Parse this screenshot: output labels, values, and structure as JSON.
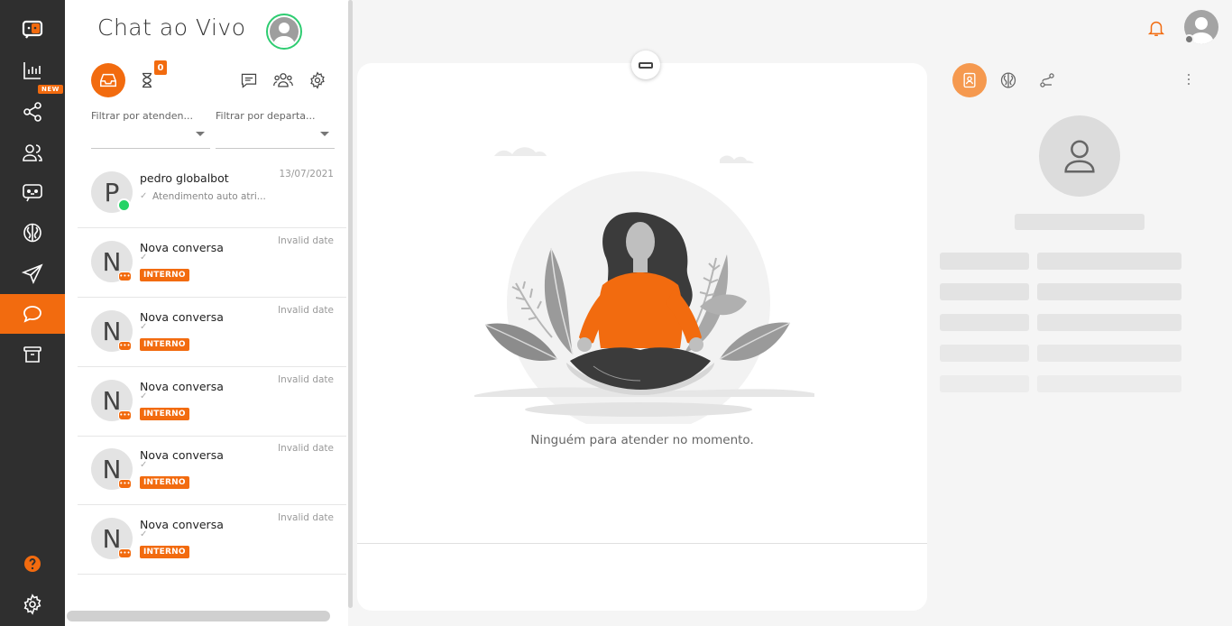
{
  "nav": {
    "items": [
      {
        "name": "logo",
        "icon": "chat-bot-logo-icon"
      },
      {
        "name": "dashboard",
        "icon": "bar-chart-icon"
      },
      {
        "name": "integrations",
        "icon": "share-nodes-icon",
        "badge": "NEW"
      },
      {
        "name": "contacts",
        "icon": "users-icon"
      },
      {
        "name": "bots",
        "icon": "bot-chat-icon"
      },
      {
        "name": "ai",
        "icon": "brain-icon"
      },
      {
        "name": "campaigns",
        "icon": "paper-plane-icon"
      },
      {
        "name": "live-chat",
        "icon": "chat-bubble-icon",
        "active": true
      },
      {
        "name": "archive",
        "icon": "archive-box-icon"
      },
      {
        "name": "help",
        "icon": "help-icon"
      },
      {
        "name": "settings",
        "icon": "gear-icon"
      }
    ]
  },
  "panel": {
    "title": "Chat ao Vivo",
    "queue_count": "0",
    "filter_agent": "Filtrar por atenden...",
    "filter_department": "Filtrar por departa...",
    "conversations": [
      {
        "initial": "P",
        "name": "pedro globalbot",
        "date": "13/07/2021",
        "preview": "Atendimento auto atri...",
        "badge": "",
        "channel": "whatsapp"
      },
      {
        "initial": "N",
        "name": "Nova conversa",
        "date": "Invalid date",
        "preview": "",
        "badge": "INTERNO",
        "channel": "internal"
      },
      {
        "initial": "N",
        "name": "Nova conversa",
        "date": "Invalid date",
        "preview": "",
        "badge": "INTERNO",
        "channel": "internal"
      },
      {
        "initial": "N",
        "name": "Nova conversa",
        "date": "Invalid date",
        "preview": "",
        "badge": "INTERNO",
        "channel": "internal"
      },
      {
        "initial": "N",
        "name": "Nova conversa",
        "date": "Invalid date",
        "preview": "",
        "badge": "INTERNO",
        "channel": "internal"
      },
      {
        "initial": "N",
        "name": "Nova conversa",
        "date": "Invalid date",
        "preview": "",
        "badge": "INTERNO",
        "channel": "internal"
      }
    ]
  },
  "chat": {
    "empty_message": "Ninguém para atender no momento."
  },
  "colors": {
    "accent": "#f26b0f",
    "nav_bg": "#2f2f2f",
    "online": "#2ecc71",
    "whatsapp": "#25d366"
  }
}
